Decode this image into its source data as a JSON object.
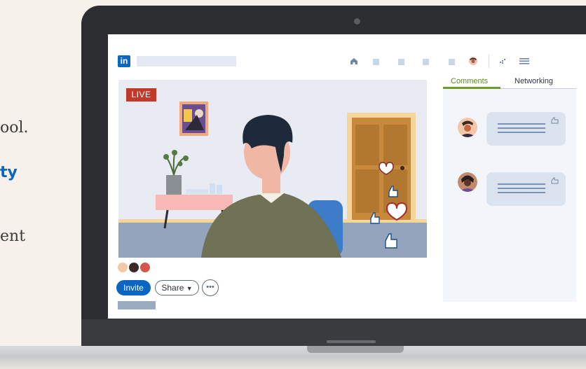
{
  "left_text": {
    "line1": "ool.",
    "line2": "ty",
    "line3": "ent"
  },
  "app": {
    "logo_text": "in"
  },
  "nav": {
    "icons": [
      "home-icon",
      "network-icon",
      "jobs-icon",
      "messaging-icon",
      "notifications-icon",
      "me-avatar-icon",
      "work-icon",
      "menu-icon"
    ]
  },
  "video": {
    "live_badge": "LIVE"
  },
  "controls": {
    "invite_label": "Invite",
    "share_label": "Share",
    "more_label": "•••"
  },
  "sidebar": {
    "tabs": [
      {
        "label": "Comments",
        "active": true
      },
      {
        "label": "Networking",
        "active": false
      }
    ]
  },
  "colors": {
    "brand": "#0a66c2",
    "live": "#c0392b",
    "tab_active": "#6f9c2d"
  }
}
